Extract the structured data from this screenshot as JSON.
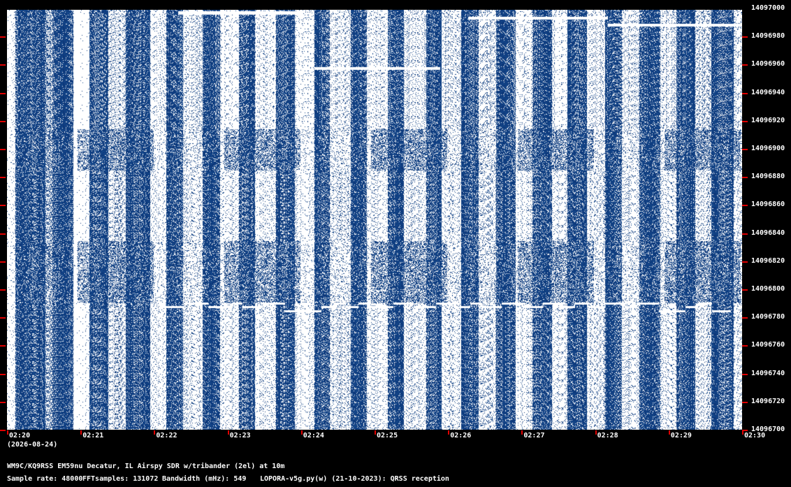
{
  "y_axis": {
    "labels": [
      "14097000",
      "14096980",
      "14096960",
      "14096940",
      "14096920",
      "14096900",
      "14096880",
      "14096860",
      "14096840",
      "14096820",
      "14096800",
      "14096780",
      "14096760",
      "14096740",
      "14096720",
      "14096700"
    ]
  },
  "x_axis": {
    "labels": [
      "02:20",
      "02:21",
      "02:22",
      "02:23",
      "02:24",
      "02:25",
      "02:26",
      "02:27",
      "02:28",
      "02:29",
      "02:30"
    ],
    "date": "(2026-08-24)"
  },
  "info": {
    "station": "WM9C/KQ9RSS EM59nu Decatur, IL  Airspy SDR w/tribander (2el) at 10m",
    "sample_rate": "Sample rate: 48000",
    "fft_samples": "FFTsamples: 131072",
    "bandwidth": "Bandwidth (mHz): 549",
    "software": "LOPORA-v5g.py(w) (21-10-2023): QRSS reception"
  },
  "colors": {
    "background": "#000000",
    "waterfall_base": "#0b3a78",
    "signal": "#ffffff",
    "tick": "#e00000"
  }
}
